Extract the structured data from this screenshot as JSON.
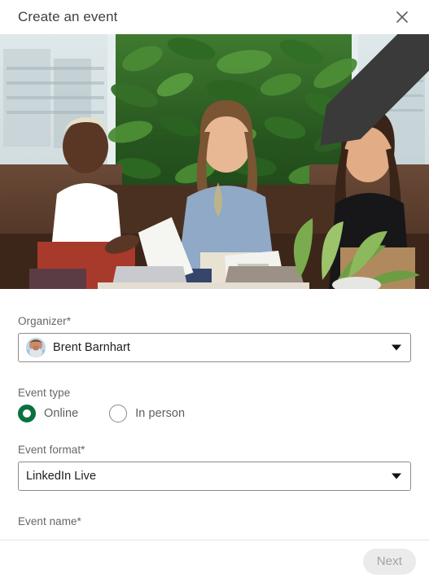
{
  "header": {
    "title": "Create an event",
    "close_icon": "close-icon"
  },
  "banner": {
    "alt": "three-women-seated-on-sofa-with-green-plant-wall",
    "edit_icon": "pencil-icon"
  },
  "form": {
    "organizer": {
      "label": "Organizer*",
      "value": "Brent Barnhart",
      "avatar_icon": "avatar-photo",
      "caret_icon": "chevron-down-icon"
    },
    "event_type": {
      "label": "Event type",
      "selected": "Online",
      "options": [
        {
          "label": "Online",
          "selected": true
        },
        {
          "label": "In person",
          "selected": false
        }
      ]
    },
    "event_format": {
      "label": "Event format*",
      "value": "LinkedIn Live",
      "caret_icon": "chevron-down-icon"
    },
    "event_name": {
      "label": "Event name*"
    }
  },
  "footer": {
    "next_label": "Next",
    "next_disabled": true
  },
  "colors": {
    "accent_green": "#0a7040",
    "text_primary": "#1d1d1d",
    "text_secondary": "#666666",
    "border": "#8c8c8c",
    "disabled_bg": "#ebebeb",
    "disabled_text": "#a3a3a3"
  }
}
